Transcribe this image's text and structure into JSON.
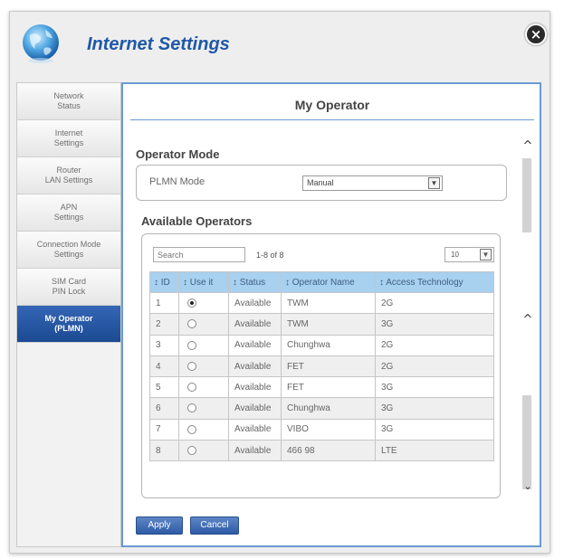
{
  "app": {
    "title": "Internet Settings",
    "close_label": "×"
  },
  "sidebar": {
    "items": [
      {
        "label": "Network\nStatus",
        "active": false
      },
      {
        "label": "Internet\nSettings",
        "active": false
      },
      {
        "label": "Router\nLAN Settings",
        "active": false
      },
      {
        "label": "APN\nSettings",
        "active": false
      },
      {
        "label": "Connection Mode\nSettings",
        "active": false
      },
      {
        "label": "SIM Card\nPIN Lock",
        "active": false
      },
      {
        "label": "My Operator\n(PLMN)",
        "active": true
      }
    ]
  },
  "panel": {
    "title": "My Operator",
    "operator_mode": {
      "heading": "Operator Mode",
      "plmn_label": "PLMN Mode",
      "plmn_value": "Manual"
    },
    "available": {
      "heading": "Available Operators",
      "search_placeholder": "Search",
      "count_text": "1-8 of 8",
      "page_size": "10",
      "columns": [
        "↕ ID",
        "↕ Use it",
        "↕ Status",
        "↕ Operator Name",
        "↕ Access Technology"
      ],
      "rows": [
        {
          "id": "1",
          "selected": true,
          "status": "Available",
          "name": "TWM",
          "tech": "2G"
        },
        {
          "id": "2",
          "selected": false,
          "status": "Available",
          "name": "TWM",
          "tech": "3G"
        },
        {
          "id": "3",
          "selected": false,
          "status": "Available",
          "name": "Chunghwa",
          "tech": "2G"
        },
        {
          "id": "4",
          "selected": false,
          "status": "Available",
          "name": "FET",
          "tech": "2G"
        },
        {
          "id": "5",
          "selected": false,
          "status": "Available",
          "name": "FET",
          "tech": "3G"
        },
        {
          "id": "6",
          "selected": false,
          "status": "Available",
          "name": "Chunghwa",
          "tech": "3G"
        },
        {
          "id": "7",
          "selected": false,
          "status": "Available",
          "name": "VIBO",
          "tech": "3G"
        },
        {
          "id": "8",
          "selected": false,
          "status": "Available",
          "name": "466 98",
          "tech": "LTE"
        }
      ]
    },
    "buttons": {
      "apply": "Apply",
      "cancel": "Cancel"
    }
  },
  "colors": {
    "title_blue": "#1f58a8",
    "active_nav": "#2a5aa8",
    "table_header": "#a8d0ef",
    "panel_border": "#6a9ad4"
  },
  "icons": {
    "app": "globe-icon",
    "close": "close-icon"
  }
}
